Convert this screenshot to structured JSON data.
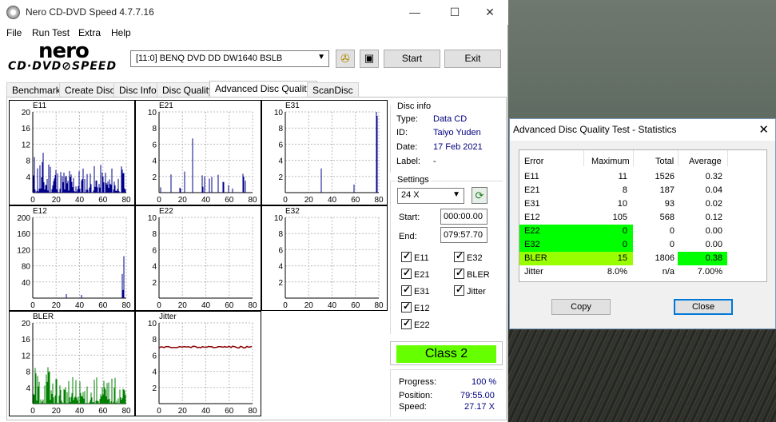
{
  "window": {
    "title": "Nero CD-DVD Speed 4.7.7.16",
    "minimize": "—",
    "maximize": "☐",
    "close": "✕"
  },
  "menu": [
    "File",
    "Run Test",
    "Extra",
    "Help"
  ],
  "logo": {
    "line1": "nero",
    "line2": "CD·DVD⊘SPEED"
  },
  "toolbar": {
    "drive": "[11:0]   BENQ DVD DD DW1640 BSLB",
    "start_label": "Start",
    "exit_label": "Exit"
  },
  "tabs": [
    "Benchmark",
    "Create Disc",
    "Disc Info",
    "Disc Quality",
    "Advanced Disc Quality",
    "ScanDisc"
  ],
  "active_tab": "Advanced Disc Quality",
  "graphs": [
    {
      "id": "e11",
      "label": "E11",
      "yticks": [
        "20",
        "16",
        "12",
        "8",
        "4"
      ],
      "ymax": 20,
      "xticks": [
        "0",
        "20",
        "40",
        "60",
        "80"
      ],
      "color": "#00008b"
    },
    {
      "id": "e21",
      "label": "E21",
      "yticks": [
        "10",
        "8",
        "6",
        "4",
        "2"
      ],
      "ymax": 10,
      "xticks": [
        "0",
        "20",
        "40",
        "60",
        "80"
      ],
      "color": "#00008b"
    },
    {
      "id": "e31",
      "label": "E31",
      "yticks": [
        "10",
        "8",
        "6",
        "4",
        "2"
      ],
      "ymax": 10,
      "xticks": [
        "0",
        "20",
        "40",
        "60",
        "80"
      ],
      "color": "#00008b"
    },
    {
      "id": "e12",
      "label": "E12",
      "yticks": [
        "200",
        "160",
        "120",
        "80",
        "40"
      ],
      "ymax": 200,
      "xticks": [
        "0",
        "20",
        "40",
        "60",
        "80"
      ],
      "color": "#00008b"
    },
    {
      "id": "e22",
      "label": "E22",
      "yticks": [
        "10",
        "8",
        "6",
        "4",
        "2"
      ],
      "ymax": 10,
      "xticks": [
        "0",
        "20",
        "40",
        "60",
        "80"
      ],
      "color": "#00008b"
    },
    {
      "id": "e32",
      "label": "E32",
      "yticks": [
        "10",
        "8",
        "6",
        "4",
        "2"
      ],
      "ymax": 10,
      "xticks": [
        "0",
        "20",
        "40",
        "60",
        "80"
      ],
      "color": "#00008b"
    },
    {
      "id": "bler",
      "label": "BLER",
      "yticks": [
        "20",
        "16",
        "12",
        "8",
        "4"
      ],
      "ymax": 20,
      "xticks": [
        "0",
        "20",
        "40",
        "60",
        "80"
      ],
      "color": "#008000"
    },
    {
      "id": "jitter",
      "label": "Jitter",
      "yticks": [
        "10",
        "8",
        "6",
        "4",
        "2"
      ],
      "ymax": 10,
      "xticks": [
        "0",
        "20",
        "40",
        "60",
        "80"
      ],
      "color": "#8b0000"
    }
  ],
  "disc_info": {
    "title": "Disc info",
    "type_label": "Type:",
    "type": "Data CD",
    "id_label": "ID:",
    "id": "Taiyo Yuden",
    "date_label": "Date:",
    "date": "17 Feb 2021",
    "label_label": "Label:",
    "label": "-"
  },
  "settings": {
    "title": "Settings",
    "speed": "24 X",
    "start_label": "Start:",
    "start": "000:00.00",
    "end_label": "End:",
    "end": "079:57.70",
    "checks": [
      "E11",
      "E32",
      "E21",
      "BLER",
      "E31",
      "Jitter",
      "E12",
      "E22"
    ]
  },
  "class_label": "Class 2",
  "progress": {
    "progress_label": "Progress:",
    "progress": "100 %",
    "position_label": "Position:",
    "position": "79:55.00",
    "speed_label": "Speed:",
    "speed": "27.17 X"
  },
  "stats": {
    "title": "Advanced Disc Quality Test - Statistics",
    "headers": [
      "Error",
      "Maximum",
      "Total",
      "Average"
    ],
    "rows": [
      {
        "error": "E11",
        "maximum": "11",
        "total": "1526",
        "average": "0.32"
      },
      {
        "error": "E21",
        "maximum": "8",
        "total": "187",
        "average": "0.04"
      },
      {
        "error": "E31",
        "maximum": "10",
        "total": "93",
        "average": "0.02"
      },
      {
        "error": "E12",
        "maximum": "105",
        "total": "568",
        "average": "0.12"
      },
      {
        "error": "E22",
        "maximum": "0",
        "total": "0",
        "average": "0.00"
      },
      {
        "error": "E32",
        "maximum": "0",
        "total": "0",
        "average": "0.00"
      },
      {
        "error": "BLER",
        "maximum": "15",
        "total": "1806",
        "average": "0.38"
      },
      {
        "error": "Jitter",
        "maximum": "8.0%",
        "total": "n/a",
        "average": "7.00%"
      }
    ],
    "copy_label": "Copy",
    "close_label": "Close",
    "highlight_green": "#00ff00",
    "highlight_yellowgreen": "#99ff00"
  }
}
